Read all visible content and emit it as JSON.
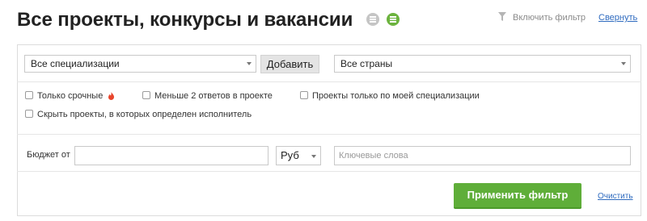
{
  "header": {
    "title": "Все проекты, конкурсы и вакансии",
    "icons": [
      "list-icon",
      "rss-feed-icon"
    ],
    "enable_filter": "Включить фильтр",
    "collapse": "Свернуть"
  },
  "filter": {
    "specialization_select": "Все специализации",
    "add_button": "Добавить",
    "country_select": "Все страны",
    "checkboxes": {
      "urgent": "Только срочные",
      "fewer_answers": "Меньше 2 ответов в проекте",
      "my_specialization": "Проекты только по моей специализации",
      "hide_assigned": "Скрыть проекты, в которых определен исполнитель"
    },
    "budget_label": "Бюджет от",
    "budget_value": "",
    "currency_select": "Руб",
    "keywords_placeholder": "Ключевые слова",
    "apply_button": "Применить фильтр",
    "clear_link": "Очистить"
  },
  "colors": {
    "apply_button": "#5fae39",
    "link": "#2f6bbf",
    "feed_icon": "#6cb33e",
    "list_icon": "#c5c5c5",
    "urgent_flame": "#e8452c"
  }
}
